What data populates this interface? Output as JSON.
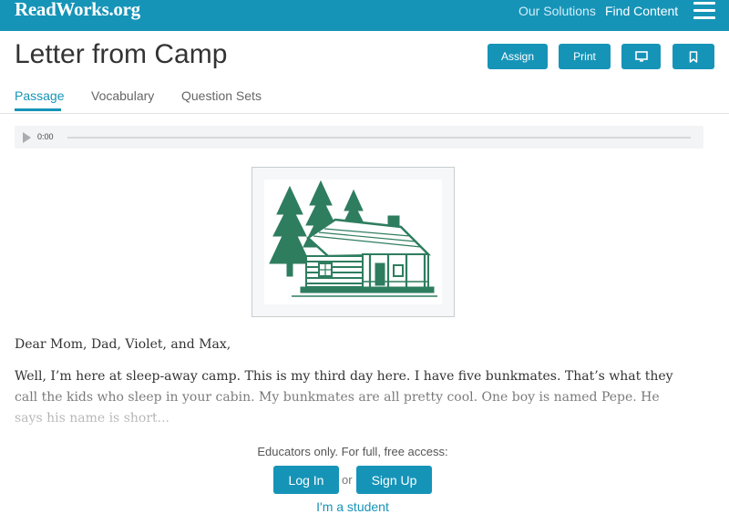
{
  "header": {
    "logo": "ReadWorks.org",
    "nav": [
      "Our Solutions",
      "Find Content"
    ],
    "menu_icon": "hamburger-menu-icon",
    "brand_color": "#1694b8"
  },
  "page": {
    "title": "Letter from Camp",
    "actions": {
      "assign": "Assign",
      "print": "Print",
      "present_icon": "monitor-icon",
      "save_icon": "bookmark-icon"
    },
    "tabs": [
      "Passage",
      "Vocabulary",
      "Question Sets"
    ],
    "active_tab": "Passage"
  },
  "audio": {
    "time": "0:00",
    "progress": 0,
    "play_icon": "play-icon"
  },
  "illustration": {
    "subject": "log cabin with pine trees",
    "color": "#2e7d5f"
  },
  "passage": {
    "salutation": "Dear Mom, Dad, Violet, and Max,",
    "paragraph": "Well, I’m here at sleep-away camp. This is my third day here. I have five bunkmates. That’s what they call the kids who sleep in your cabin. My bunkmates are all pretty cool. One boy is named Pepe. He says his name is short..."
  },
  "access_gate": {
    "note": "Educators only. For full, free access:",
    "login": "Log In",
    "or": "or",
    "signup": "Sign Up",
    "student_link": "I'm a student"
  }
}
